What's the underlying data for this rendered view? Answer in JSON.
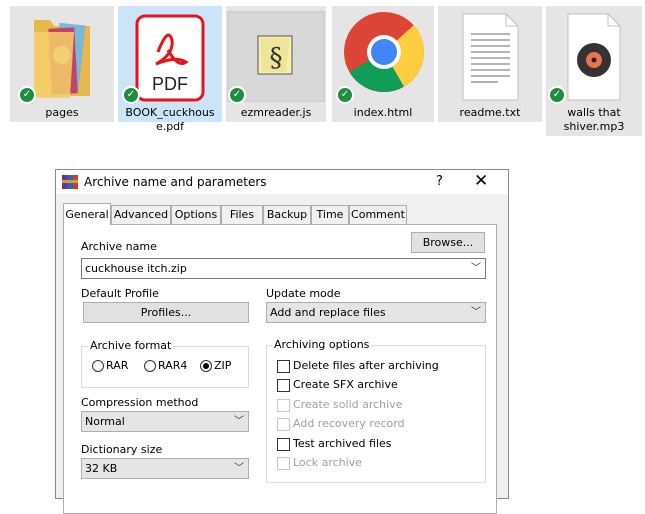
{
  "files": [
    {
      "name": "pages",
      "icon": "folder-icon"
    },
    {
      "name_line1": "BOOK_cuckhous",
      "name_line2": "e.pdf",
      "icon": "pdf-icon",
      "badge": "PDF"
    },
    {
      "name": "ezmreader.js",
      "icon": "js-script-icon"
    },
    {
      "name": "index.html",
      "icon": "chrome-icon"
    },
    {
      "name": "readme.txt",
      "icon": "text-file-icon"
    },
    {
      "name_line1": "walls that",
      "name_line2": "shiver.mp3",
      "icon": "music-file-icon"
    }
  ],
  "dialog": {
    "title": "Archive name and parameters",
    "help": "?",
    "close": "✕",
    "tabs": [
      "General",
      "Advanced",
      "Options",
      "Files",
      "Backup",
      "Time",
      "Comment"
    ],
    "archive_name_label": "Archive name",
    "browse_label": "Browse...",
    "archive_name_value": "cuckhouse itch.zip",
    "default_profile_label": "Default Profile",
    "profiles_label": "Profiles...",
    "update_mode_label": "Update mode",
    "update_mode_value": "Add and replace files",
    "archive_format_label": "Archive format",
    "formats": [
      "RAR",
      "RAR4",
      "ZIP"
    ],
    "selected_format": "ZIP",
    "compression_method_label": "Compression method",
    "compression_method_value": "Normal",
    "dictionary_size_label": "Dictionary size",
    "dictionary_size_value": "32 KB",
    "archiving_options_label": "Archiving options",
    "options": [
      {
        "label": "Delete files after archiving",
        "enabled": true,
        "checked": false
      },
      {
        "label": "Create SFX archive",
        "enabled": true,
        "checked": false
      },
      {
        "label": "Create solid archive",
        "enabled": false,
        "checked": false
      },
      {
        "label": "Add recovery record",
        "enabled": false,
        "checked": false
      },
      {
        "label": "Test archived files",
        "enabled": true,
        "checked": false
      },
      {
        "label": "Lock archive",
        "enabled": false,
        "checked": false
      }
    ]
  }
}
